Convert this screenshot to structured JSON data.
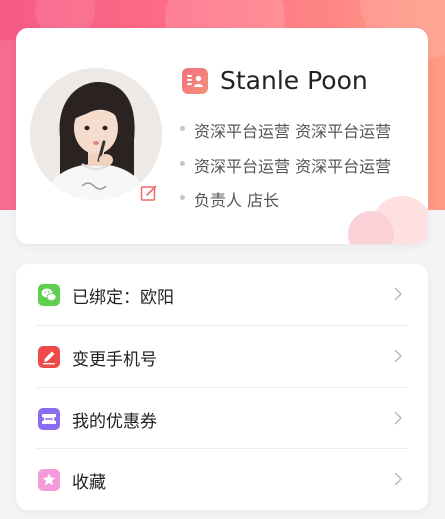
{
  "profile": {
    "name": "Stanle Poon",
    "info": [
      "资深平台运营 资深平台运营",
      "资深平台运营 资深平台运营",
      "负责人 店长"
    ]
  },
  "menu": {
    "items": [
      {
        "label": "已绑定：欧阳",
        "icon": "wechat-icon",
        "color": "#5fcf4e"
      },
      {
        "label": "变更手机号",
        "icon": "pencil-icon",
        "color": "#ee4a4a"
      },
      {
        "label": "我的优惠券",
        "icon": "coupon-icon",
        "color": "#8a6cf0"
      },
      {
        "label": "收藏",
        "icon": "star-icon",
        "color": "#f39bd9"
      }
    ]
  },
  "colors": {
    "header_start": "#f65a86",
    "header_end": "#ff9b84",
    "accent": "#f26e7d"
  }
}
